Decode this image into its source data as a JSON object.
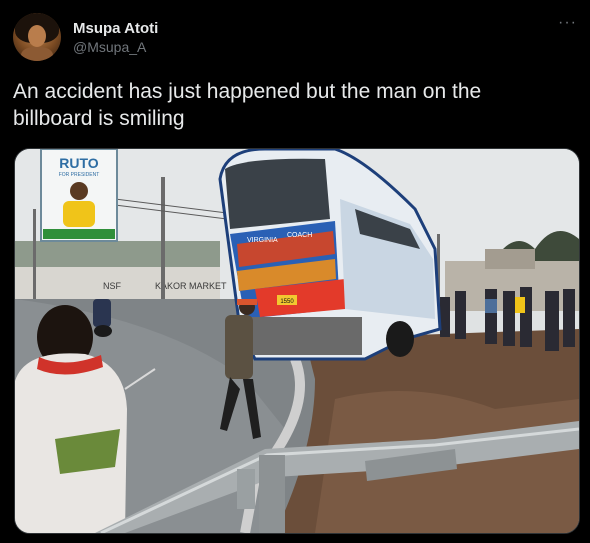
{
  "author": {
    "display_name": "Msupa Atoti",
    "handle": "@Msupa_A"
  },
  "menu": {
    "more_label": "···"
  },
  "tweet": {
    "text": "An accident has just happened but the man on the\nbillboard is smiling"
  },
  "image": {
    "billboard_title": "RUTO",
    "billboard_subtitle": "FOR PRESIDENT",
    "bus_company_left": "VIRGINIA",
    "bus_company_right": "COACH",
    "bus_plate": "1550",
    "wall_sign": "KAKOR MARKET",
    "wall_sign_left": "NSF"
  },
  "colors": {
    "background": "#000000",
    "text_primary": "#e7e9ea",
    "text_secondary": "#71767b",
    "border": "#2f3336"
  }
}
